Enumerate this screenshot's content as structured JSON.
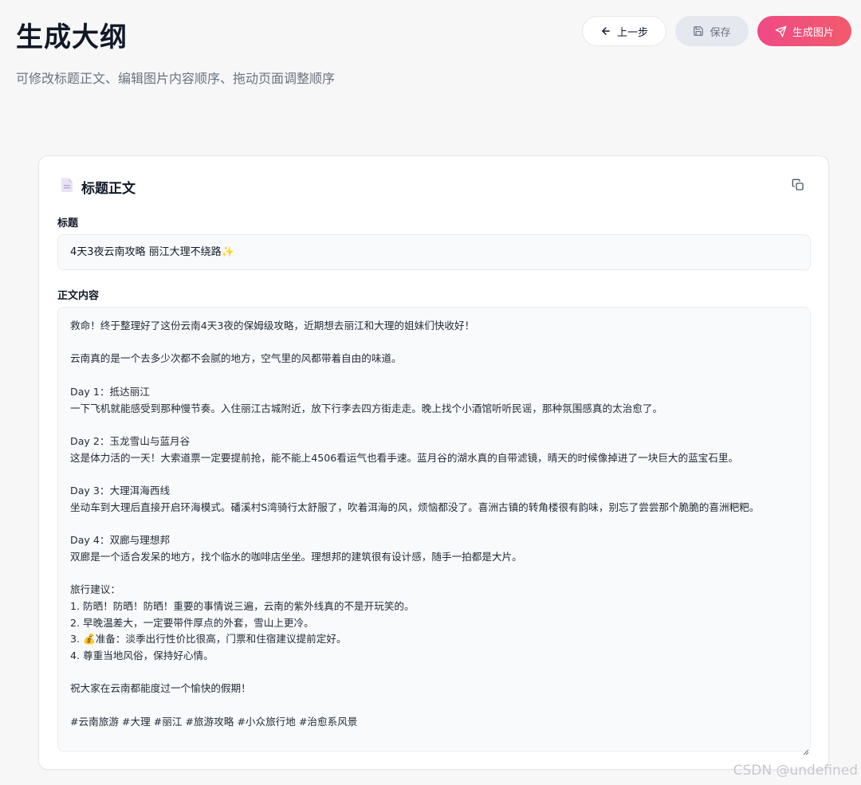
{
  "header": {
    "title": "生成大纲",
    "subtitle": "可修改标题正文、编辑图片内容顺序、拖动页面调整顺序"
  },
  "toolbar": {
    "back_label": "上一步",
    "back_icon": "arrow-left-icon",
    "save_label": "保存",
    "save_icon": "save-icon",
    "generate_label": "生成图片",
    "generate_icon": "send-icon"
  },
  "card": {
    "title": "标题正文",
    "icon": "document-icon",
    "copy_icon": "copy-icon",
    "title_label": "标题",
    "title_value": "4天3夜云南攻略 丽江大理不绕路✨",
    "body_label": "正文内容",
    "body_value": "救命！终于整理好了这份云南4天3夜的保姆级攻略，近期想去丽江和大理的姐妹们快收好！\n\n云南真的是一个去多少次都不会腻的地方，空气里的风都带着自由的味道。\n\nDay 1：抵达丽江\n一下飞机就能感受到那种慢节奏。入住丽江古城附近，放下行李去四方街走走。晚上找个小酒馆听听民谣，那种氛围感真的太治愈了。\n\nDay 2：玉龙雪山与蓝月谷\n这是体力活的一天！大索道票一定要提前抢，能不能上4506看运气也看手速。蓝月谷的湖水真的自带滤镜，晴天的时候像掉进了一块巨大的蓝宝石里。\n\nDay 3：大理洱海西线\n坐动车到大理后直接开启环海模式。磻溪村S湾骑行太舒服了，吹着洱海的风，烦恼都没了。喜洲古镇的转角楼很有韵味，别忘了尝尝那个脆脆的喜洲粑粑。\n\nDay 4：双廊与理想邦\n双廊是一个适合发呆的地方，找个临水的咖啡店坐坐。理想邦的建筑很有设计感，随手一拍都是大片。\n\n旅行建议：\n1. 防晒！防晒！防晒！重要的事情说三遍，云南的紫外线真的不是开玩笑的。\n2. 早晚温差大，一定要带件厚点的外套，雪山上更冷。\n3. 💰准备：淡季出行性价比很高，门票和住宿建议提前定好。\n4. 尊重当地风俗，保持好心情。\n\n祝大家在云南都能度过一个愉快的假期！\n\n#云南旅游 #大理 #丽江 #旅游攻略 #小众旅行地 #治愈系风景"
  },
  "watermark": "CSDN @undefined",
  "colors": {
    "accent_start": "#ef4a86",
    "accent_end": "#f25a6c",
    "background": "#f7f7f8"
  }
}
